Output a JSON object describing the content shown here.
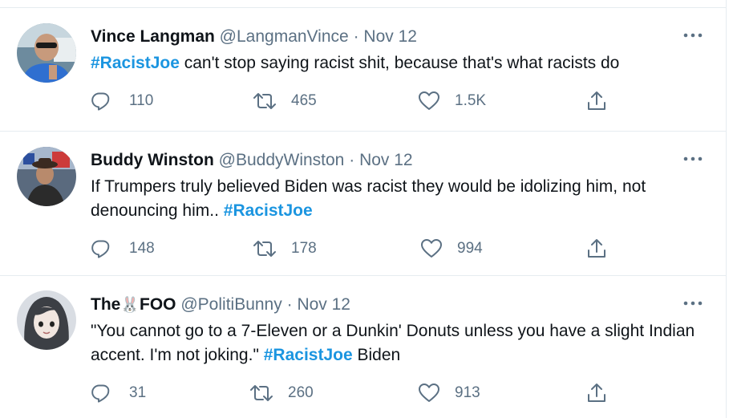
{
  "tweets": [
    {
      "name": "Vince Langman",
      "handle": "@LangmanVince",
      "separator": "·",
      "date": "Nov 12",
      "text_hashtag": "#RacistJoe",
      "text_rest": "can't stop saying racist shit, because that's what racists do",
      "replies": "110",
      "retweets": "465",
      "likes": "1.5K"
    },
    {
      "name": "Buddy Winston",
      "handle": "@BuddyWinston",
      "separator": "·",
      "date": "Nov 12",
      "text_before": "If Trumpers truly believed Biden was racist they would be idolizing him, not denouncing him..",
      "text_hashtag": "#RacistJoe",
      "replies": "148",
      "retweets": "178",
      "likes": "994"
    },
    {
      "name_part1": "The",
      "name_emoji": "🐰",
      "name_part2": "FOO",
      "handle": "@PolitiBunny",
      "separator": "·",
      "date": "Nov 12",
      "text_before": "\"You cannot go to a 7-Eleven or a Dunkin' Donuts unless you have a slight Indian accent. I'm not joking.\"",
      "text_hashtag": "#RacistJoe",
      "text_after": "Biden",
      "replies": "31",
      "retweets": "260",
      "likes": "913"
    }
  ],
  "icons": {
    "reply": "reply-icon",
    "retweet": "retweet-icon",
    "like": "heart-icon",
    "share": "share-icon",
    "more": "more-icon"
  },
  "colors": {
    "hashtag": "#1b95e0",
    "secondary_text": "#5b7083",
    "divider": "#e6ecf0"
  }
}
